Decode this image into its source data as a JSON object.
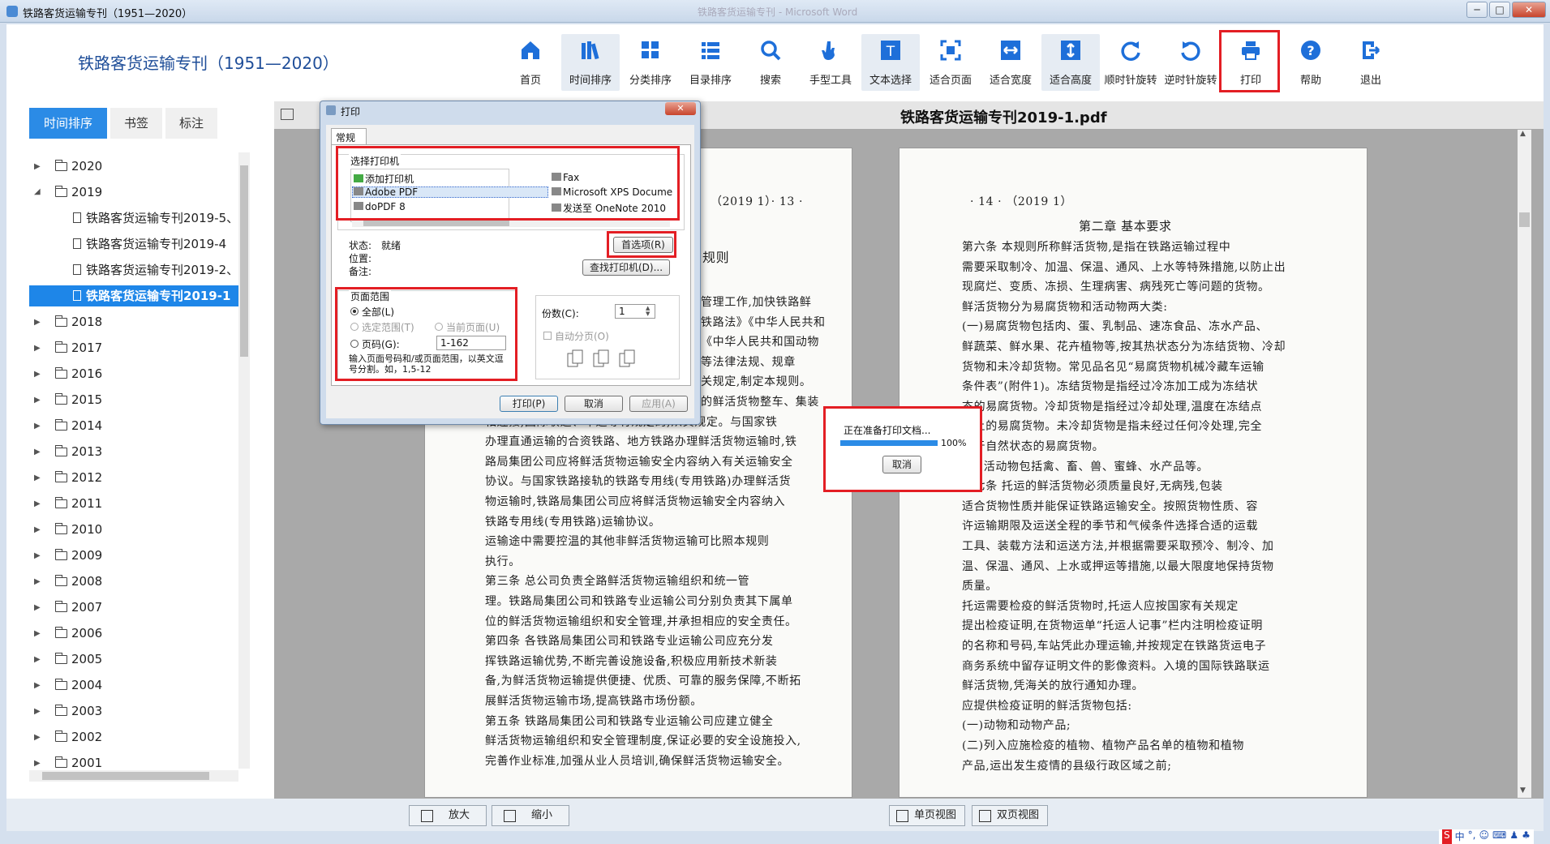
{
  "window": {
    "title": "铁路客货运输专刊（1951—2020）",
    "center_title": "铁路客货运输专刊 - Microsoft Word"
  },
  "header": {
    "app_title": "铁路客货运输专刊（1951—2020）"
  },
  "toolbar": [
    {
      "id": "home",
      "label": "首页",
      "icon": "home-icon"
    },
    {
      "id": "time-sort",
      "label": "时间排序",
      "icon": "books-icon",
      "active": true
    },
    {
      "id": "category-sort",
      "label": "分类排序",
      "icon": "grid-icon"
    },
    {
      "id": "catalog-sort",
      "label": "目录排序",
      "icon": "list-icon"
    },
    {
      "id": "search",
      "label": "搜索",
      "icon": "search-icon"
    },
    {
      "id": "hand-tool",
      "label": "手型工具",
      "icon": "hand-icon"
    },
    {
      "id": "text-select",
      "label": "文本选择",
      "icon": "text-select-icon",
      "active": true
    },
    {
      "id": "fit-page",
      "label": "适合页面",
      "icon": "fit-page-icon"
    },
    {
      "id": "fit-width",
      "label": "适合宽度",
      "icon": "fit-width-icon"
    },
    {
      "id": "fit-height",
      "label": "适合高度",
      "icon": "fit-height-icon",
      "active": true
    },
    {
      "id": "rotate-cw",
      "label": "顺时针旋转",
      "icon": "rotate-cw-icon"
    },
    {
      "id": "rotate-ccw",
      "label": "逆时针旋转",
      "icon": "rotate-ccw-icon"
    },
    {
      "id": "print",
      "label": "打印",
      "icon": "printer-icon"
    },
    {
      "id": "help",
      "label": "帮助",
      "icon": "help-icon"
    },
    {
      "id": "exit",
      "label": "退出",
      "icon": "exit-icon"
    }
  ],
  "side_tabs": [
    "时间排序",
    "书签",
    "标注"
  ],
  "tree": [
    {
      "type": "year",
      "label": "2020",
      "expanded": false
    },
    {
      "type": "year",
      "label": "2019",
      "expanded": true
    },
    {
      "type": "doc",
      "label": "铁路客货运输专刊2019-5、"
    },
    {
      "type": "doc",
      "label": "铁路客货运输专刊2019-4"
    },
    {
      "type": "doc",
      "label": "铁路客货运输专刊2019-2、"
    },
    {
      "type": "doc",
      "label": "铁路客货运输专刊2019-1",
      "selected": true
    },
    {
      "type": "year",
      "label": "2018"
    },
    {
      "type": "year",
      "label": "2017"
    },
    {
      "type": "year",
      "label": "2016"
    },
    {
      "type": "year",
      "label": "2015"
    },
    {
      "type": "year",
      "label": "2014"
    },
    {
      "type": "year",
      "label": "2013"
    },
    {
      "type": "year",
      "label": "2012"
    },
    {
      "type": "year",
      "label": "2011"
    },
    {
      "type": "year",
      "label": "2010"
    },
    {
      "type": "year",
      "label": "2009"
    },
    {
      "type": "year",
      "label": "2008"
    },
    {
      "type": "year",
      "label": "2007"
    },
    {
      "type": "year",
      "label": "2006"
    },
    {
      "type": "year",
      "label": "2005"
    },
    {
      "type": "year",
      "label": "2004"
    },
    {
      "type": "year",
      "label": "2003"
    },
    {
      "type": "year",
      "label": "2002"
    },
    {
      "type": "year",
      "label": "2001"
    }
  ],
  "viewer": {
    "doc_title": "铁路客货运输专刊2019-1.pdf",
    "left_page": {
      "header": "（2019  1）· 13 ·",
      "heading_frag": "规则",
      "lines_right_visible": [
        "管理工作,加快铁路鲜",
        "铁路法》《中华人民共和",
        "《中华人民共和国动物",
        "等法律法规、规章",
        "关规定,制定本规则。",
        "的鲜活货物整车、集装",
        "相连接,国际联运、军运等有规定的,从其规定。与国家铁",
        "办理直通运输的合资铁路、地方铁路办理鲜活货物运输时,铁",
        "路局集团公司应将鲜活货物运输安全内容纳入有关运输安全",
        "协议。与国家铁路接轨的铁路专用线(专用铁路)办理鲜活货",
        "物运输时,铁路局集团公司应将鲜活货物运输安全内容纳入",
        "铁路专用线(专用铁路)运输协议。",
        "    运输途中需要控温的其他非鲜活货物运输可比照本规则",
        "执行。",
        "    第三条    总公司负责全路鲜活货物运输组织和统一管",
        "理。铁路局集团公司和铁路专业运输公司分别负责其下属单",
        "位的鲜活货物运输组织和安全管理,并承担相应的安全责任。",
        "    第四条    各铁路局集团公司和铁路专业运输公司应充分发",
        "挥铁路运输优势,不断完善设施设备,积极应用新技术新装",
        "备,为鲜活货物运输提供便捷、优质、可靠的服务保障,不断拓",
        "展鲜活货物运输市场,提高铁路市场份额。",
        "    第五条    铁路局集团公司和铁路专业运输公司应建立健全",
        "鲜活货物运输组织和安全管理制度,保证必要的安全设施投入,",
        "完善作业标准,加强从业人员培训,确保鲜活货物运输安全。"
      ]
    },
    "right_page": {
      "header": "· 14 ·  （2019  1）",
      "chapter": "第二章    基本要求",
      "lines": [
        "    第六条    本规则所称鲜活货物,是指在铁路运输过程中",
        "需要采取制冷、加温、保温、通风、上水等特殊措施,以防止出",
        "现腐烂、变质、冻损、生理病害、病残死亡等问题的货物。",
        "    鲜活货物分为易腐货物和活动物两大类:",
        "    (一)易腐货物包括肉、蛋、乳制品、速冻食品、冻水产品、",
        "鲜蔬菜、鲜水果、花卉植物等,按其热状态分为冻结货物、冷却",
        "货物和未冷却货物。常见品名见“易腐货物机械冷藏车运输",
        "条件表”(附件1)。冻结货物是指经过冷冻加工成为冻结状",
        "态的易腐货物。冷却货物是指经过冷却处理,温度在冻结点",
        "以上的易腐货物。未冷却货物是指未经过任何冷处理,完全",
        "处于自然状态的易腐货物。",
        "    (二)活动物包括禽、畜、兽、蜜蜂、水产品等。",
        "    第七条    托运的鲜活货物必须质量良好,无病残,包装",
        "适合货物性质并能保证铁路运输安全。按照货物性质、容",
        "许运输期限及运送全程的季节和气候条件选择合适的运载",
        "工具、装载方法和运送方法,并根据需要采取预冷、制冷、加",
        "温、保温、通风、上水或押运等措施,以最大限度地保持货物",
        "质量。",
        "    托运需要检疫的鲜活货物时,托运人应按国家有关规定",
        "提出检疫证明,在货物运单“托运人记事”栏内注明检疫证明",
        "的名称和号码,车站凭此办理运输,并按规定在铁路货运电子",
        "商务系统中留存证明文件的影像资料。入境的国际铁路联运",
        "鲜活货物,凭海关的放行通知办理。",
        "    应提供检疫证明的鲜活货物包括:",
        "    (一)动物和动物产品;",
        "    (二)列入应施检疫的植物、植物产品名单的植物和植物",
        "产品,运出发生疫情的县级行政区域之前;"
      ]
    }
  },
  "bottom": {
    "zoom_in": "放大",
    "zoom_out": "缩小",
    "single_view": "单页视图",
    "double_view": "双页视图"
  },
  "print_dialog": {
    "title": "打印",
    "tab": "常规",
    "select_printer": "选择打印机",
    "printers": [
      {
        "name": "添加打印机",
        "icon": "add-printer-icon"
      },
      {
        "name": "Fax",
        "icon": "printer-icon"
      },
      {
        "name": "Adobe PDF",
        "icon": "printer-icon",
        "selected": true
      },
      {
        "name": "Microsoft XPS Docume",
        "icon": "printer-icon"
      },
      {
        "name": "doPDF 8",
        "icon": "printer-icon"
      },
      {
        "name": "发送至 OneNote 2010",
        "icon": "printer-icon"
      }
    ],
    "status_label": "状态:",
    "status_value": "就绪",
    "location_label": "位置:",
    "comment_label": "备注:",
    "preferences_btn": "首选项(R)",
    "find_printer_btn": "查找打印机(D)...",
    "page_range": "页面范围",
    "all": "全部(L)",
    "selection": "选定范围(T)",
    "current_page": "当前页面(U)",
    "pages": "页码(G):",
    "pages_value": "1-162",
    "hint": "输入页面号码和/或页面范围，以英文逗号分割。如，1,5-12",
    "copies_label": "份数(C):",
    "copies_value": "1",
    "collate": "自动分页(O)",
    "print_btn": "打印(P)",
    "cancel_btn": "取消",
    "apply_btn": "应用(A)"
  },
  "progress_dialog": {
    "message": "正在准备打印文档...",
    "percent": "100%",
    "progress": 1.0,
    "cancel": "取消"
  },
  "tray": [
    "S",
    "中",
    "°,",
    "☺",
    "⌨",
    "♟",
    "♣"
  ],
  "colors": {
    "accent": "#2b8be6",
    "highlight": "#e31e24",
    "viewer_bg": "#a9a9a9",
    "icon_blue": "#1e6fd9"
  }
}
